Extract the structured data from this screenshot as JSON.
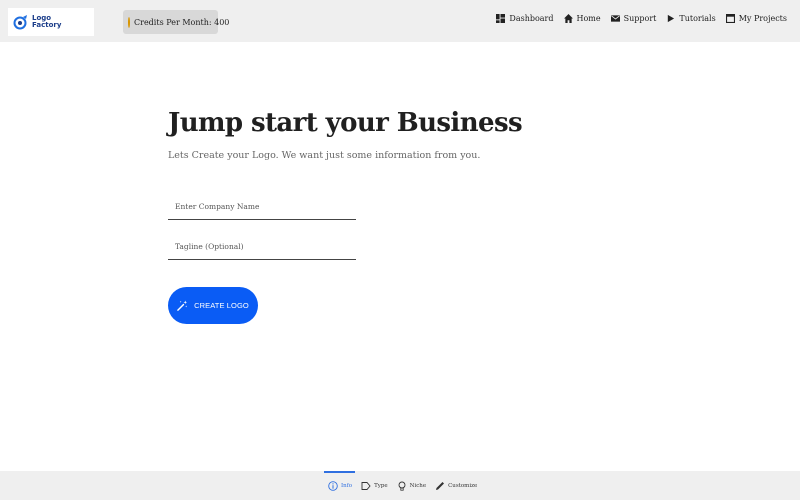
{
  "brand": {
    "name_line1": "Logo",
    "name_line2": "Factory"
  },
  "credits": {
    "label": "Credits Per Month: 400"
  },
  "nav": {
    "items": [
      {
        "label": "Dashboard",
        "icon": "dashboard-icon"
      },
      {
        "label": "Home",
        "icon": "home-icon"
      },
      {
        "label": "Support",
        "icon": "mail-icon"
      },
      {
        "label": "Tutorials",
        "icon": "play-icon"
      },
      {
        "label": "My Projects",
        "icon": "projects-icon"
      }
    ]
  },
  "main": {
    "title": "Jump start your Business",
    "subtitle": "Lets Create your Logo. We want just some information from you.",
    "company_field": {
      "placeholder": "Enter Company Name",
      "value": ""
    },
    "tagline_field": {
      "placeholder": "Tagline (Optional)",
      "value": ""
    },
    "create_button": {
      "label": "CREATE LOGO",
      "icon": "magic-wand-icon"
    }
  },
  "steps": {
    "items": [
      {
        "label": "Info",
        "icon": "info-icon",
        "active": true
      },
      {
        "label": "Type",
        "icon": "tag-icon",
        "active": false
      },
      {
        "label": "Niche",
        "icon": "lightbulb-icon",
        "active": false
      },
      {
        "label": "Customize",
        "icon": "pencil-icon",
        "active": false
      }
    ]
  },
  "colors": {
    "accent": "#0a5cf5",
    "active_step": "#2f6fe0",
    "header_bg": "#efefef",
    "coin": "#f2b600"
  }
}
